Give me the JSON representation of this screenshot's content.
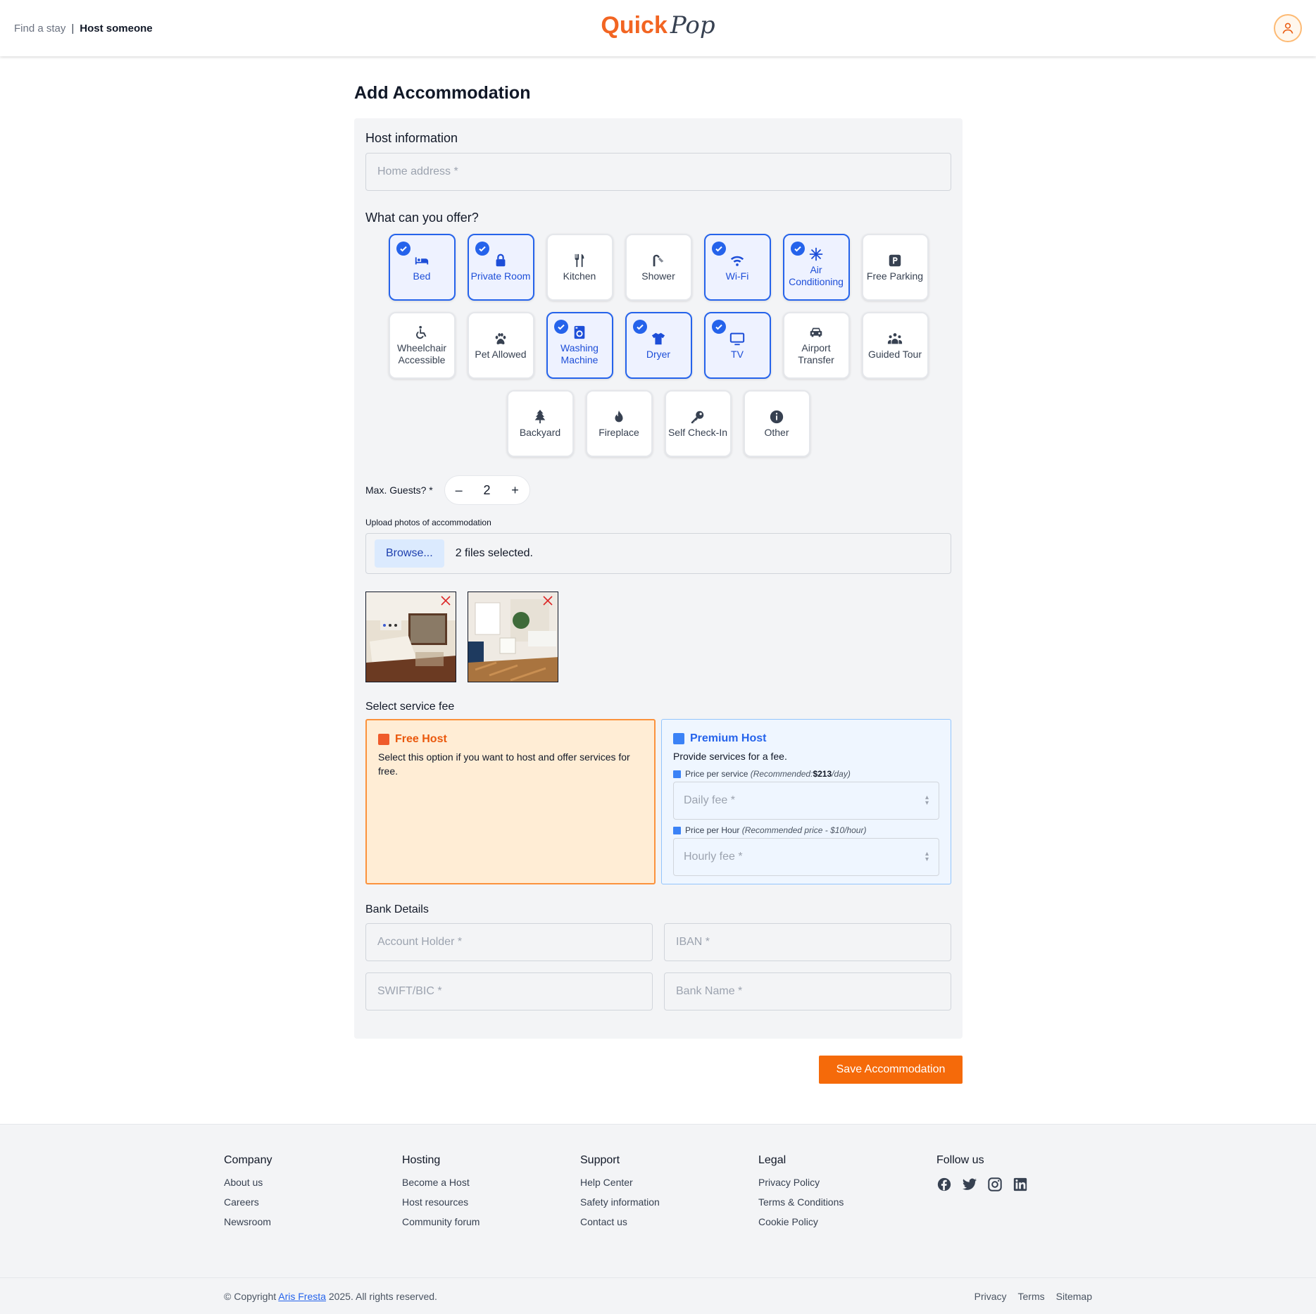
{
  "header": {
    "find_stay": "Find a stay",
    "separator": "|",
    "host_someone": "Host someone",
    "logo_quick": "Quick",
    "logo_pop": "Pop"
  },
  "page_title": "Add Accommodation",
  "host_info": {
    "title": "Host information",
    "address_placeholder": "Home address *"
  },
  "offer": {
    "title": "What can you offer?",
    "rows": [
      [
        {
          "label": "Bed",
          "icon": "bed-icon",
          "selected": true
        },
        {
          "label": "Private Room",
          "icon": "lock-icon",
          "selected": true
        },
        {
          "label": "Kitchen",
          "icon": "utensils-icon",
          "selected": false
        },
        {
          "label": "Shower",
          "icon": "shower-icon",
          "selected": false
        },
        {
          "label": "Wi-Fi",
          "icon": "wifi-icon",
          "selected": true
        },
        {
          "label": "Air Conditioning",
          "icon": "snowflake-icon",
          "selected": true
        },
        {
          "label": "Free Parking",
          "icon": "parking-icon",
          "selected": false
        }
      ],
      [
        {
          "label": "Wheelchair Accessible",
          "icon": "wheelchair-icon",
          "selected": false
        },
        {
          "label": "Pet Allowed",
          "icon": "paw-icon",
          "selected": false
        },
        {
          "label": "Washing Machine",
          "icon": "washing-machine-icon",
          "selected": true
        },
        {
          "label": "Dryer",
          "icon": "shirt-icon",
          "selected": true
        },
        {
          "label": "TV",
          "icon": "tv-icon",
          "selected": true
        },
        {
          "label": "Airport Transfer",
          "icon": "car-icon",
          "selected": false
        },
        {
          "label": "Guided Tour",
          "icon": "group-icon",
          "selected": false
        }
      ],
      [
        {
          "label": "Backyard",
          "icon": "tree-icon",
          "selected": false
        },
        {
          "label": "Fireplace",
          "icon": "fire-icon",
          "selected": false
        },
        {
          "label": "Self Check-In",
          "icon": "key-icon",
          "selected": false
        },
        {
          "label": "Other",
          "icon": "info-icon",
          "selected": false
        }
      ]
    ]
  },
  "guests": {
    "label": "Max. Guests? *",
    "minus": "–",
    "value": "2",
    "plus": "+"
  },
  "upload": {
    "label": "Upload photos of accommodation",
    "browse": "Browse...",
    "status": "2 files selected."
  },
  "service_fee": {
    "title": "Select service fee",
    "free": {
      "title": "Free Host",
      "desc": "Select this option if you want to host and offer services for free."
    },
    "premium": {
      "title": "Premium Host",
      "desc": "Provide services for a fee.",
      "per_service_label": "Price per service",
      "per_service_rec_prefix": "(Recommended: ",
      "per_service_rec_value": "$213",
      "per_service_rec_suffix": "/day)",
      "daily_placeholder": "Daily fee *",
      "per_hour_label": "Price per Hour",
      "per_hour_rec": "(Recommended price - $10/hour)",
      "hourly_placeholder": "Hourly fee *"
    }
  },
  "bank": {
    "title": "Bank Details",
    "account_holder": "Account Holder *",
    "iban": "IBAN *",
    "swift": "SWIFT/BIC *",
    "bank_name": "Bank Name *"
  },
  "save_label": "Save Accommodation",
  "footer": {
    "columns": [
      {
        "title": "Company",
        "links": [
          "About us",
          "Careers",
          "Newsroom"
        ]
      },
      {
        "title": "Hosting",
        "links": [
          "Become a Host",
          "Host resources",
          "Community forum"
        ]
      },
      {
        "title": "Support",
        "links": [
          "Help Center",
          "Safety information",
          "Contact us"
        ]
      },
      {
        "title": "Legal",
        "links": [
          "Privacy Policy",
          "Terms & Conditions",
          "Cookie Policy"
        ]
      }
    ],
    "follow_title": "Follow us",
    "social_icons": [
      "facebook-icon",
      "twitter-icon",
      "instagram-icon",
      "linkedin-icon"
    ],
    "copyright_prefix": "© Copyright ",
    "copyright_name": "Aris Fresta",
    "copyright_suffix": " 2025. All rights reserved.",
    "bottom_links": [
      "Privacy",
      "Terms",
      "Sitemap"
    ]
  },
  "colors": {
    "brand_orange": "#f26522",
    "selected_blue": "#2563eb"
  }
}
